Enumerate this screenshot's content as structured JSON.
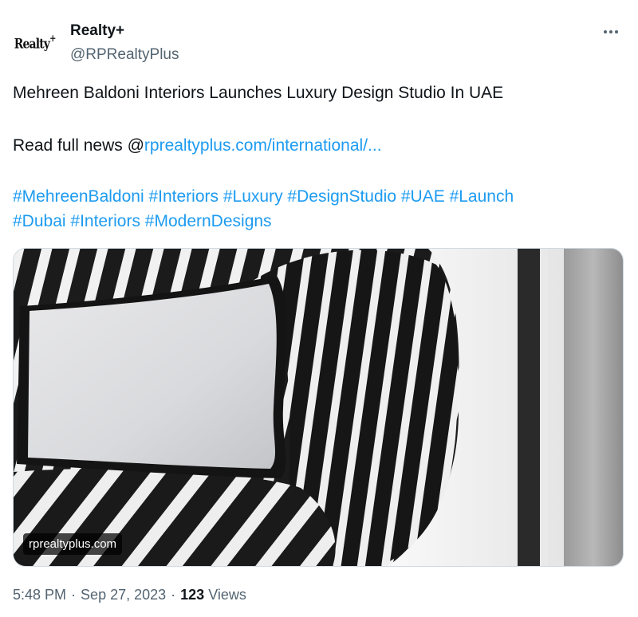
{
  "author": {
    "avatar_text": "Realty",
    "avatar_plus": "+",
    "display_name": "Realty+",
    "handle": "@RPRealtyPlus"
  },
  "menu": {
    "icon": "more-horizontal-icon"
  },
  "tweet": {
    "headline": "Mehreen Baldoni Interiors Launches Luxury Design Studio In UAE",
    "read_prefix": "Read full news @",
    "link_text": "rprealtyplus.com/international/...",
    "hashtags_line1": [
      "#MehreenBaldoni",
      "#Interiors",
      "#Luxury",
      "#DesignStudio",
      "#UAE",
      "#Launch"
    ],
    "hashtags_line2": [
      "#Dubai",
      "#Interiors",
      "#ModernDesigns"
    ]
  },
  "media": {
    "alt": "Black and white striped armchair with a white cushion",
    "domain": "rprealtyplus.com"
  },
  "meta": {
    "time": "5:48 PM",
    "date": "Sep 27, 2023",
    "separator": "·",
    "views_count": "123",
    "views_label": "Views"
  },
  "colors": {
    "link": "#1d9bf0",
    "secondary_text": "#536471",
    "primary_text": "#0f1419"
  }
}
